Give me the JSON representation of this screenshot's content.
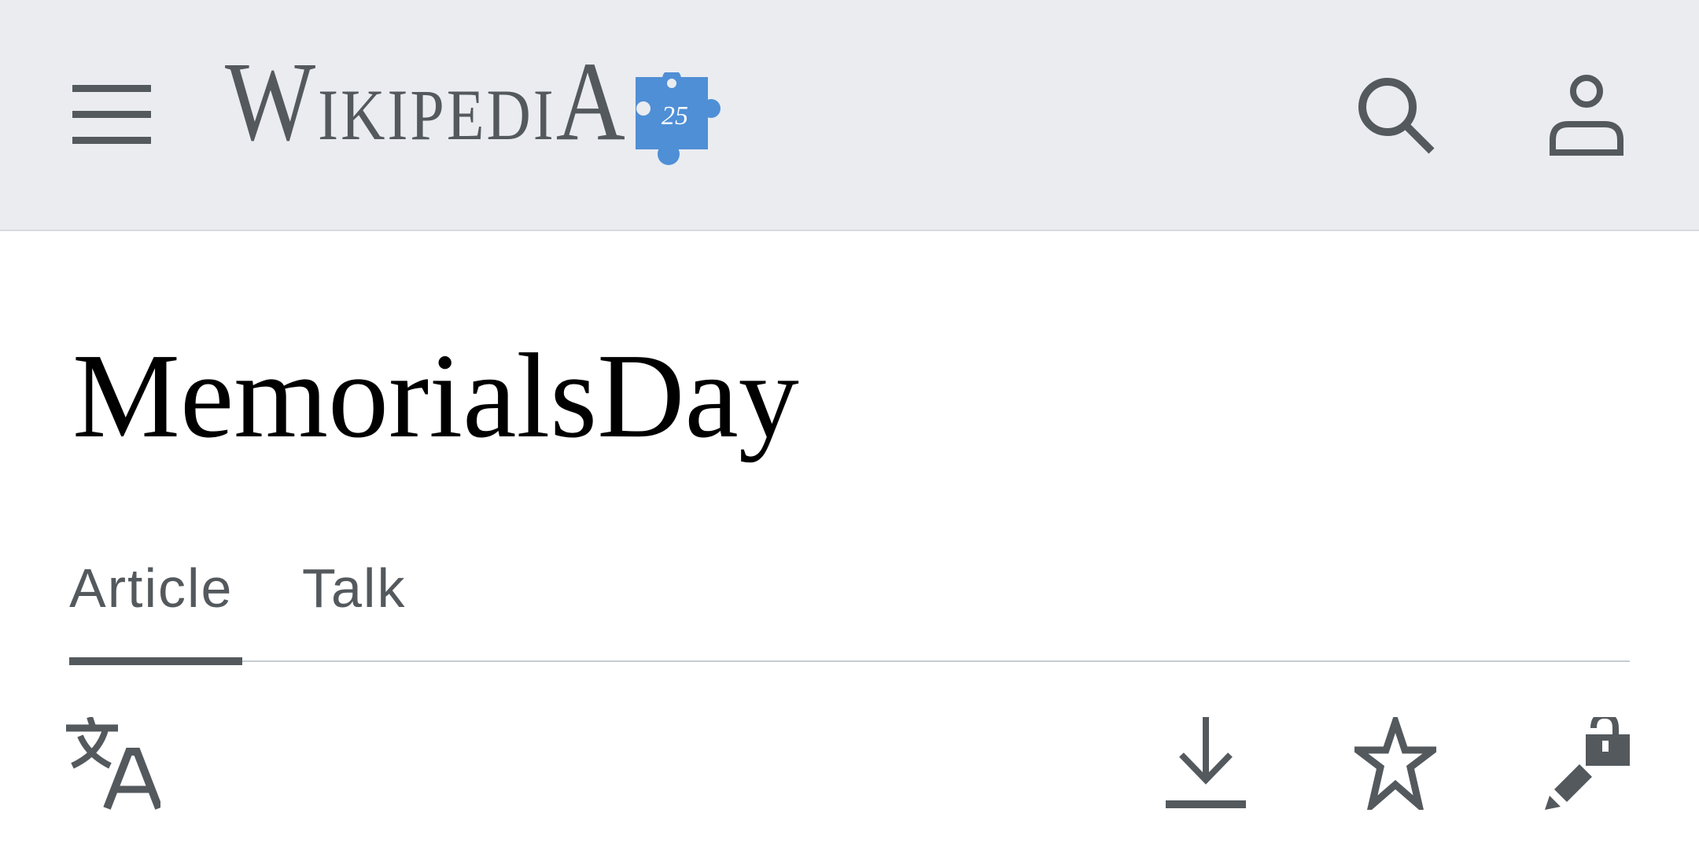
{
  "header": {
    "logo": {
      "first_letter": "W",
      "rest": "IKIPEDI",
      "last_letter": "A",
      "badge": "25"
    },
    "icons": {
      "menu": "hamburger-icon",
      "search": "search-icon",
      "user": "user-icon"
    },
    "colors": {
      "background": "#eaecf0",
      "icon": "#54595d",
      "badge": "#4f8fd6"
    }
  },
  "page": {
    "title": "MemorialsDay"
  },
  "tabs": [
    {
      "label": "Article",
      "selected": true
    },
    {
      "label": "Talk",
      "selected": false
    }
  ],
  "actions": {
    "icons": [
      "language-icon",
      "download-icon",
      "star-icon",
      "edit-lock-icon"
    ]
  }
}
